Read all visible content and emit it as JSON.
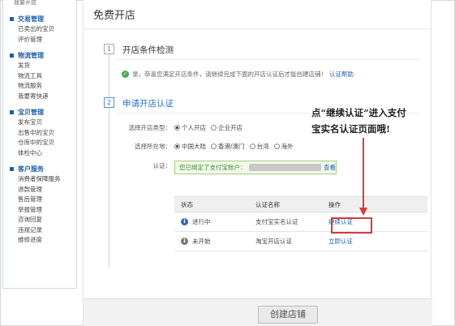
{
  "sidebar": {
    "top_text": "我要开店",
    "groups": [
      {
        "title": "交易管理",
        "items": [
          "已卖出的宝贝",
          "评价管理"
        ]
      },
      {
        "title": "物流管理",
        "items": [
          "发货",
          "物流工具",
          "物流服务",
          "我要寄快递"
        ]
      },
      {
        "title": "宝贝管理",
        "items": [
          "发布宝贝",
          "出售中的宝贝",
          "仓库中的宝贝",
          "体检中心"
        ]
      },
      {
        "title": "客户服务",
        "items": [
          "消费者保障服务",
          "退款管理",
          "售后管理",
          "举报管理",
          "咨询回复",
          "违规记录",
          "维修进度"
        ]
      }
    ]
  },
  "main": {
    "title": "免费开店",
    "step1": {
      "num": "1",
      "title": "开店条件检测"
    },
    "ok_text": "录，恭喜您满足开店条件，请继续完成下面的开店认证后才能创建店铺！",
    "ok_link": "认证帮助",
    "step2": {
      "num": "2",
      "title": "申请开店认证"
    },
    "shop_type": {
      "label": "选择开店类型：",
      "options": [
        "个人开店",
        "企业开店"
      ]
    },
    "location": {
      "label": "选择所在地：",
      "options": [
        "中国大陆",
        "香港/澳门",
        "台湾",
        "海外"
      ]
    },
    "verify": {
      "label": "认证：",
      "text": "您已绑定了支付宝账户：",
      "link": "查看"
    },
    "table": {
      "headers": [
        "状态",
        "认证名称",
        "操作"
      ],
      "rows": [
        {
          "status": "进行中",
          "name": "支付宝实名认证",
          "action": "继续认证"
        },
        {
          "status": "未开始",
          "name": "淘宝开店认证",
          "action": "立即认证"
        }
      ]
    },
    "create_button": "创建店铺"
  },
  "annotation": {
    "line1": "点“继续认证”进入支付",
    "line2": "宝实名认证页面哦!"
  },
  "colors": {
    "link": "#1f5fa8",
    "annotation_red": "#d63b3b",
    "ok_green": "#4aa84a"
  }
}
